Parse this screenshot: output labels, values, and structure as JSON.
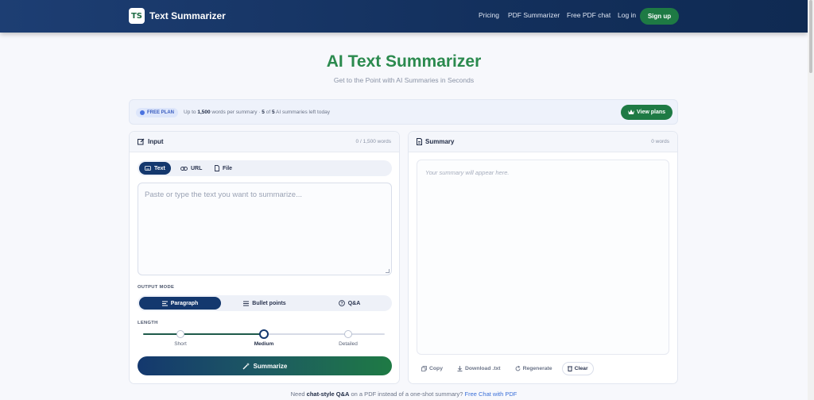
{
  "header": {
    "logo_text": "TS",
    "brand": "Text Summarizer",
    "nav": [
      "Pricing",
      "PDF Summarizer",
      "Free PDF chat",
      "Log in"
    ],
    "signup": "Sign up"
  },
  "hero": {
    "title": "AI Text Summarizer",
    "subtitle": "Get to the Point with AI Summaries in Seconds"
  },
  "plan": {
    "badge": "FREE PLAN",
    "text_prefix": "Up to ",
    "words_limit": "1,500",
    "text_mid": " words per summary · ",
    "left_count": "5",
    "text_of": " of ",
    "total_count": "5",
    "text_suffix": " AI summaries left today",
    "view_plans": "View plans"
  },
  "input_panel": {
    "title": "Input",
    "count": "0 / 1,500 words",
    "tabs": [
      "Text",
      "URL",
      "File"
    ],
    "placeholder": "Paste or type the text you want to summarize...",
    "output_mode_label": "OUTPUT MODE",
    "modes": [
      "Paragraph",
      "Bullet points",
      "Q&A"
    ],
    "length_label": "LENGTH",
    "length_options": [
      "Short",
      "Medium",
      "Detailed"
    ],
    "length_selected": "Medium",
    "summarize": "Summarize"
  },
  "summary_panel": {
    "title": "Summary",
    "count": "0 words",
    "placeholder": "Your summary will appear here.",
    "actions": [
      "Copy",
      "Download .txt",
      "Regenerate",
      "Clear"
    ]
  },
  "footer": {
    "prefix": "Need ",
    "bold": "chat-style Q&A",
    "middle": " on a PDF instead of a one-shot summary? ",
    "link": "Free Chat with PDF"
  },
  "colors": {
    "header": "#13305d",
    "accent_green": "#1e7a44",
    "accent_navy": "#14386e",
    "title_green": "#2b8a4e"
  }
}
